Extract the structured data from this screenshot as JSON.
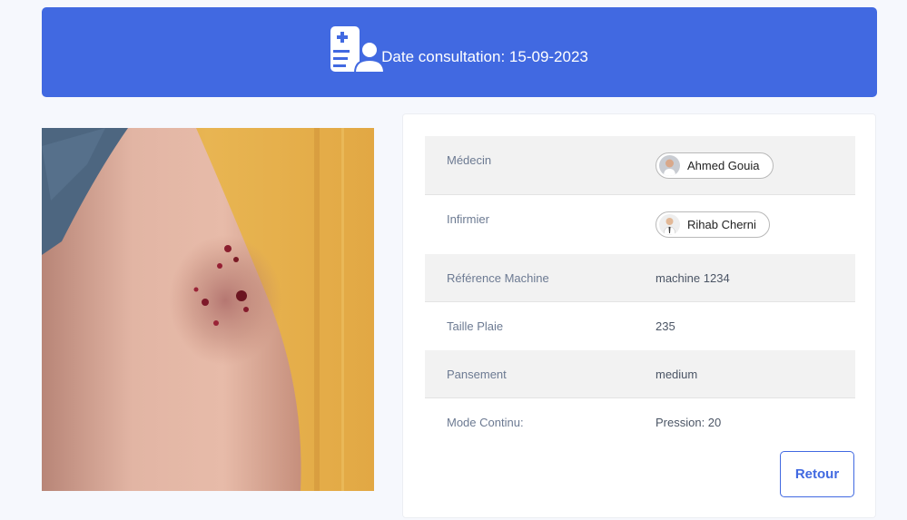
{
  "header": {
    "icon": "medical-record-patient-icon",
    "label": "Date consultation: 15-09-2023"
  },
  "photo": {
    "icon": "wound-photo"
  },
  "details": {
    "rows": [
      {
        "label": "Médecin",
        "value": "Ahmed Gouia",
        "type": "chip"
      },
      {
        "label": "Infirmier",
        "value": "Rihab Cherni",
        "type": "chip"
      },
      {
        "label": "Référence Machine",
        "value": "machine 1234"
      },
      {
        "label": "Taille Plaie",
        "value": "235"
      },
      {
        "label": "Pansement",
        "value": "medium"
      },
      {
        "label": "Mode Continu:",
        "value": "Pression: 20"
      }
    ]
  },
  "actions": {
    "back_label": "Retour"
  },
  "colors": {
    "accent": "#4169e1",
    "background": "#f6f8fd"
  }
}
